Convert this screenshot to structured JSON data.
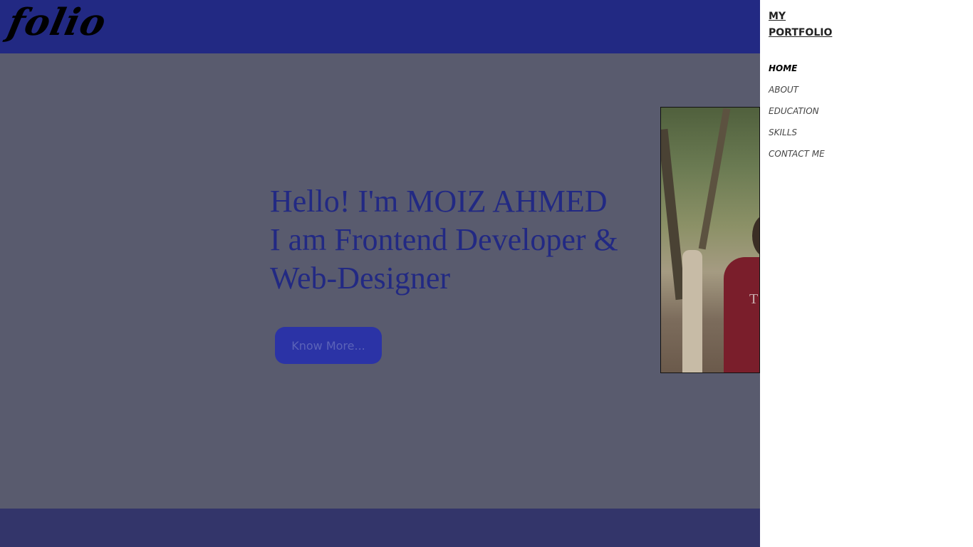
{
  "header": {
    "logo_text": "folio"
  },
  "hero": {
    "heading_lines": [
      "Hello! I'm MOIZ AHMED",
      "I am Frontend Developer &",
      "Web-Designer"
    ],
    "button_label": "Know More...",
    "photo_shirt_letter": "T"
  },
  "sidebar": {
    "title_lines": [
      "MY",
      "PORTFOLIO"
    ],
    "items": [
      {
        "label": "HOME",
        "active": true
      },
      {
        "label": "ABOUT",
        "active": false
      },
      {
        "label": "EDUCATION",
        "active": false
      },
      {
        "label": "SKILLS",
        "active": false
      },
      {
        "label": "CONTACT ME",
        "active": false
      }
    ]
  },
  "colors": {
    "header_bg": "#222983",
    "overlay_bg": "#595b6e",
    "footer_bg": "#33356a",
    "heading_text": "#222983",
    "button_bg": "#2b33a6",
    "sidebar_bg": "#ffffff"
  }
}
